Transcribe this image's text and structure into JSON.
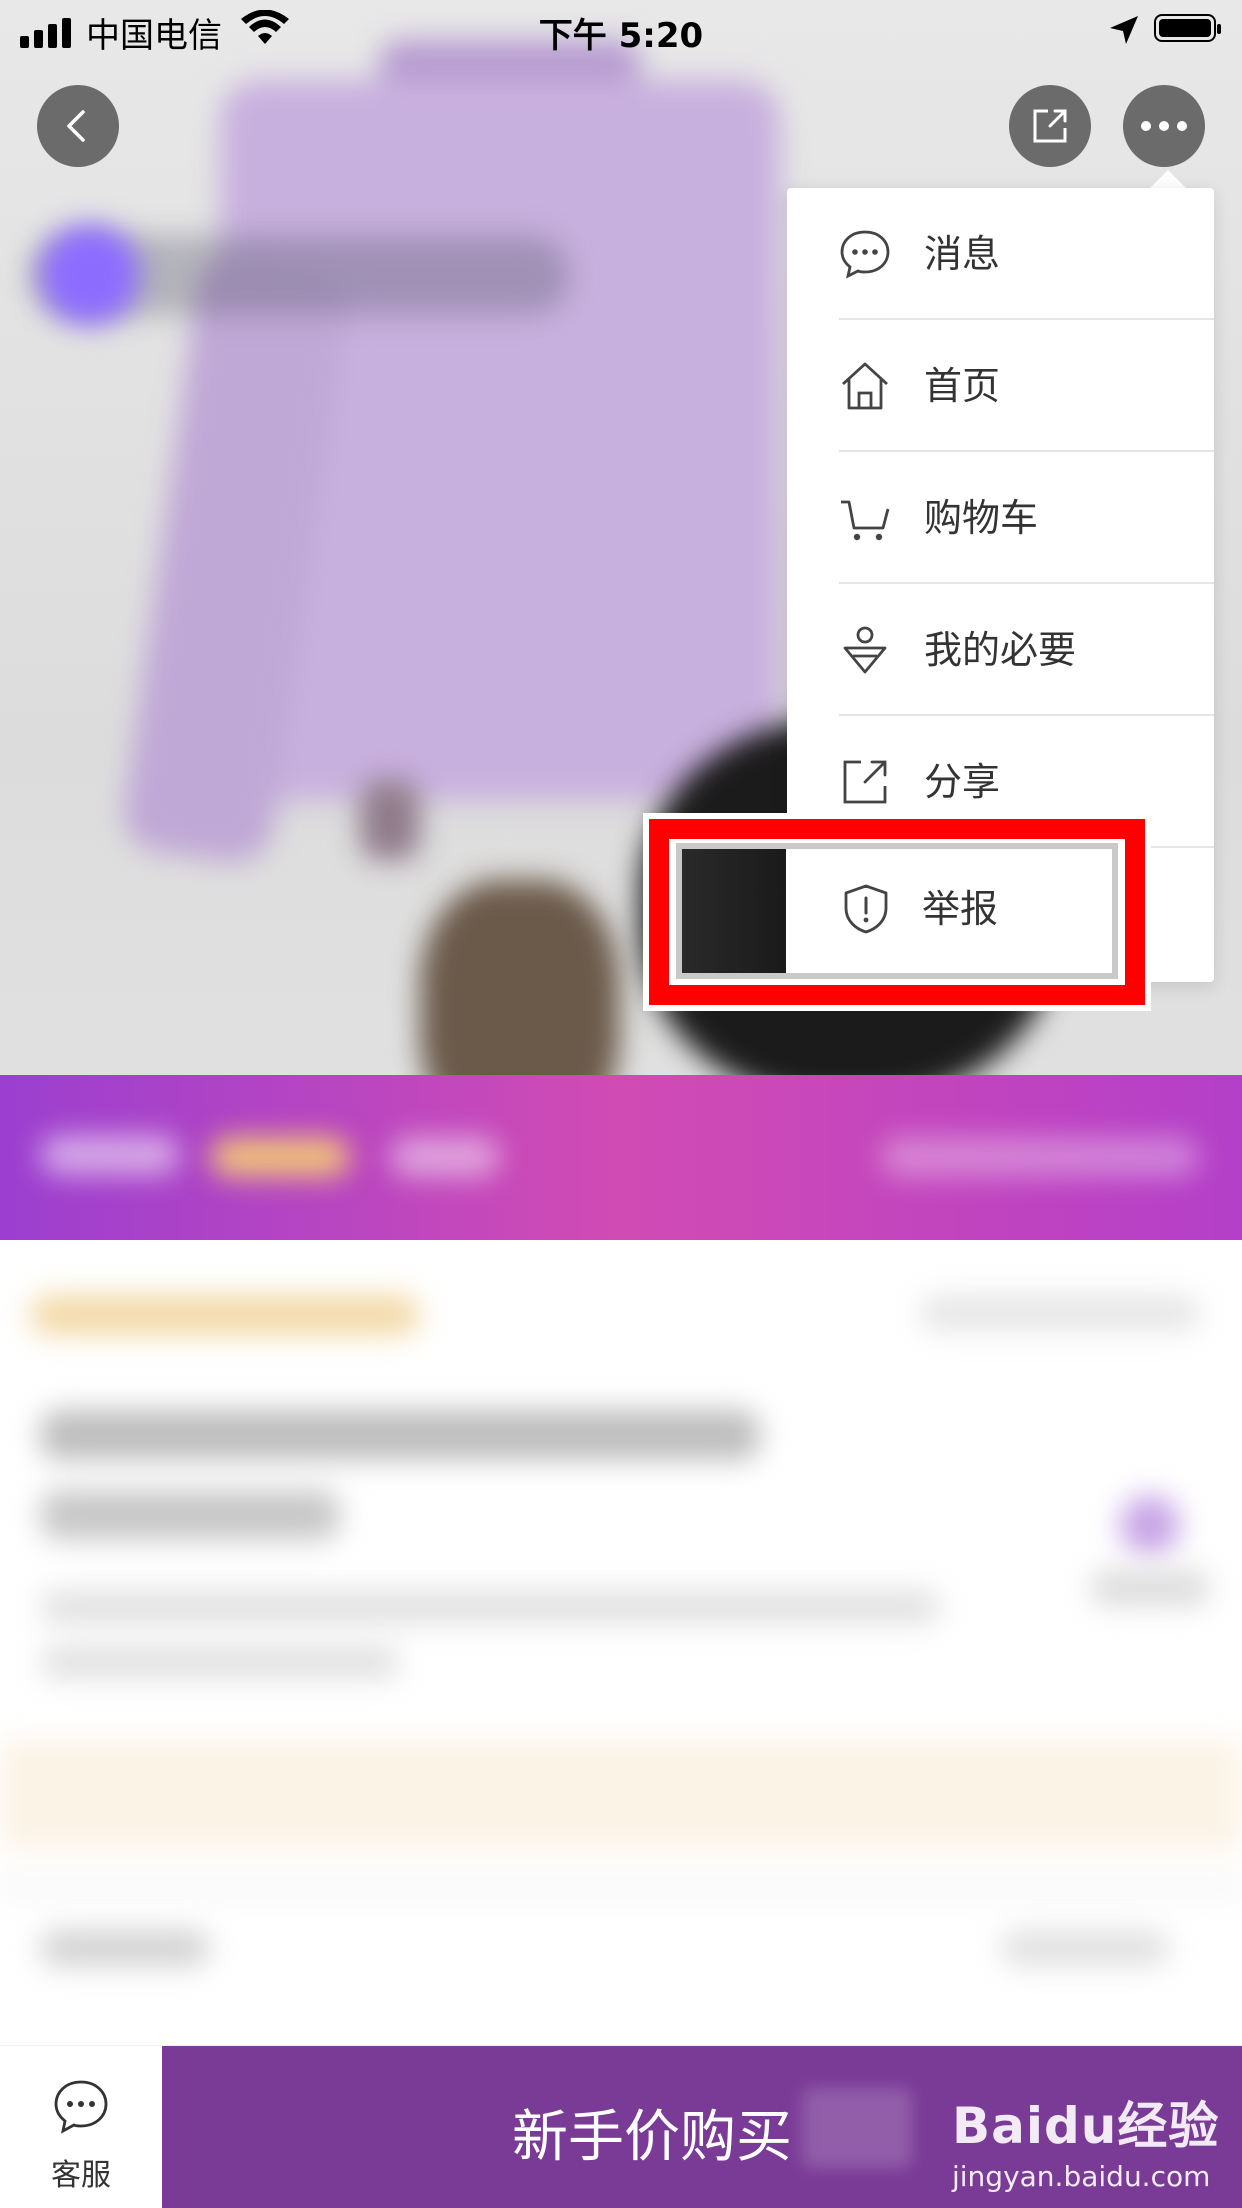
{
  "status_bar": {
    "carrier": "中国电信",
    "time": "下午 5:20"
  },
  "menu": {
    "items": [
      {
        "label": "消息",
        "icon": "message-icon"
      },
      {
        "label": "首页",
        "icon": "home-icon"
      },
      {
        "label": "购物车",
        "icon": "cart-icon"
      },
      {
        "label": "我的必要",
        "icon": "profile-icon"
      },
      {
        "label": "分享",
        "icon": "share-icon"
      },
      {
        "label": "举报",
        "icon": "report-shield-icon"
      }
    ],
    "highlighted_item": "举报",
    "highlight_color": "#ff0000"
  },
  "bottom_bar": {
    "customer_service_label": "客服",
    "buy_label": "新手价购买",
    "buy_color": "#7a3b97"
  },
  "watermark": {
    "brand": "Baidu经验",
    "url": "jingyan.baidu.com"
  },
  "colors": {
    "promo_band": "#c445c0",
    "button_overlay": "#3c3c3c"
  }
}
